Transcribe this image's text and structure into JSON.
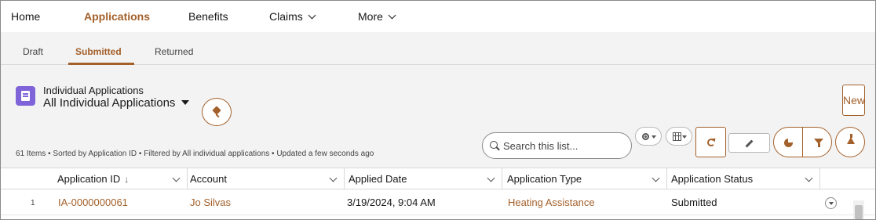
{
  "nav": {
    "items": [
      {
        "label": "Home",
        "active": false,
        "has_menu": false
      },
      {
        "label": "Applications",
        "active": true,
        "has_menu": false
      },
      {
        "label": "Benefits",
        "active": false,
        "has_menu": false
      },
      {
        "label": "Claims",
        "active": false,
        "has_menu": true
      },
      {
        "label": "More",
        "active": false,
        "has_menu": true
      }
    ]
  },
  "tabs": [
    {
      "label": "Draft",
      "active": false
    },
    {
      "label": "Submitted",
      "active": true
    },
    {
      "label": "Returned",
      "active": false
    }
  ],
  "list": {
    "object_label": "Individual Applications",
    "view_name": "All Individual Applications",
    "new_label": "New",
    "meta": "61 Items • Sorted by Application ID • Filtered by All individual applications • Updated a few seconds ago",
    "search_placeholder": "Search this list...",
    "icons": {
      "object": "application-form-icon",
      "pin": "pin-icon",
      "settings": "gear-icon",
      "display": "table-view-icon",
      "refresh": "refresh-icon",
      "edit": "pencil-icon",
      "chart": "pie-chart-icon",
      "filter": "filter-icon",
      "flask": "flask-icon"
    }
  },
  "table": {
    "columns": [
      {
        "label": "Application ID",
        "sorted": "descending",
        "sort_glyph": "↓"
      },
      {
        "label": "Account"
      },
      {
        "label": "Applied Date"
      },
      {
        "label": "Application Type"
      },
      {
        "label": "Application Status"
      }
    ],
    "rows": [
      {
        "num": "1",
        "application_id": "IA-0000000061",
        "account": "Jo Silvas",
        "applied_date": "3/19/2024, 9:04 AM",
        "application_type": "Heating Assistance",
        "application_status": "Submitted"
      }
    ]
  },
  "colors": {
    "brand": "#a3602a",
    "object_icon": "#7f63d8",
    "background": "#f3f3f3"
  }
}
